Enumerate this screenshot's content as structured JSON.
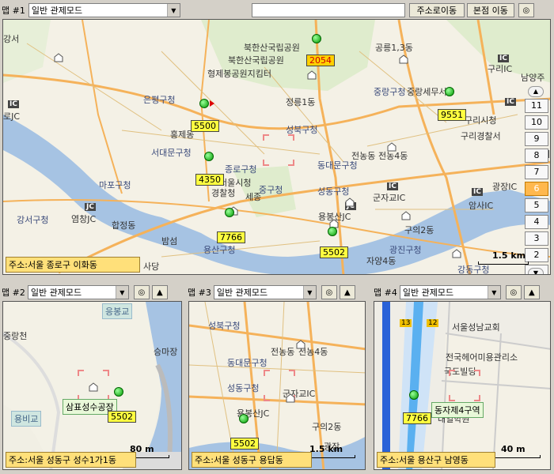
{
  "top": {
    "map_label": "맵 #1",
    "mode": "일반 관제모드",
    "address_input": "",
    "btn_address_move": "주소로이동",
    "btn_branch_move": "본점 이동"
  },
  "map1": {
    "labels": [
      {
        "t": "북한산국립공원",
        "c": "ml"
      },
      {
        "t": "북한산국립공원",
        "c": "ml"
      },
      {
        "t": "형제봉공원지킴터",
        "c": "ml"
      },
      {
        "t": "공릉1,3동",
        "c": "ml"
      },
      {
        "t": "구리IC",
        "c": "ml"
      },
      {
        "t": "남양주",
        "c": "ml"
      },
      {
        "t": "중랑구청",
        "c": "ml blue"
      },
      {
        "t": "중랑세무서",
        "c": "ml"
      },
      {
        "t": "구리시청",
        "c": "ml"
      },
      {
        "t": "구리경찰서",
        "c": "ml"
      },
      {
        "t": "은평구청",
        "c": "ml blue"
      },
      {
        "t": "정릉1동",
        "c": "ml"
      },
      {
        "t": "성북구청",
        "c": "ml blue"
      },
      {
        "t": "홍제동",
        "c": "ml"
      },
      {
        "t": "서대문구청",
        "c": "ml blue"
      },
      {
        "t": "종로구청",
        "c": "ml blue"
      },
      {
        "t": "서울시청",
        "c": "ml"
      },
      {
        "t": "경찰청",
        "c": "ml"
      },
      {
        "t": "세종",
        "c": "ml"
      },
      {
        "t": "중구청",
        "c": "ml blue"
      },
      {
        "t": "동대문구청",
        "c": "ml blue"
      },
      {
        "t": "전농동",
        "c": "ml"
      },
      {
        "t": "전농4동",
        "c": "ml"
      },
      {
        "t": "성동구청",
        "c": "ml blue"
      },
      {
        "t": "군자교IC",
        "c": "ml"
      },
      {
        "t": "광장IC",
        "c": "ml"
      },
      {
        "t": "암사IC",
        "c": "ml"
      },
      {
        "t": "용봉산JC",
        "c": "ml"
      },
      {
        "t": "마포구청",
        "c": "ml blue"
      },
      {
        "t": "강서구청",
        "c": "ml blue"
      },
      {
        "t": "염창JC",
        "c": "ml"
      },
      {
        "t": "합정동",
        "c": "ml"
      },
      {
        "t": "밤섬",
        "c": "ml"
      },
      {
        "t": "용산구청",
        "c": "ml blue"
      },
      {
        "t": "사당",
        "c": "ml"
      },
      {
        "t": "구의2동",
        "c": "ml"
      },
      {
        "t": "광진구청",
        "c": "ml blue"
      },
      {
        "t": "자양4동",
        "c": "ml"
      },
      {
        "t": "강동구청",
        "c": "ml blue"
      },
      {
        "t": "로JC",
        "c": "ml"
      },
      {
        "t": "강서",
        "c": "ml"
      }
    ],
    "vehicles": [
      "2054",
      "9551",
      "5500",
      "4350",
      "7766",
      "5502"
    ],
    "zoom_levels": [
      "11",
      "10",
      "9",
      "8",
      "7",
      "6",
      "5",
      "4",
      "3",
      "2",
      "1"
    ],
    "zoom_selected": "6",
    "scale": "1.5 km",
    "address": "주소:서울 종로구 이화동"
  },
  "map2": {
    "map_label": "맵 #2",
    "mode": "일반 관제모드",
    "labels": [
      "응봉교",
      "중랑천",
      "승마장",
      "용비교",
      "삼표성수공장"
    ],
    "vehicle": "5502",
    "scale": "80 m",
    "address": "주소:서울 성동구 성수1가1동"
  },
  "map3": {
    "map_label": "맵 #3",
    "mode": "일반 관제모드",
    "labels": [
      "성북구청",
      "전농동",
      "전농4동",
      "동대문구청",
      "성동구청",
      "군자교IC",
      "용봉산JC",
      "구의2동",
      "광장"
    ],
    "vehicle": "5502",
    "scale": "1.5 km",
    "address": "주소:서울 성동구 용답동"
  },
  "map4": {
    "map_label": "맵 #4",
    "mode": "일반 관제모드",
    "labels": [
      "서울성남교회",
      "전국헤어미용관리소",
      "국도빌딩",
      "대일학원",
      "동자제4구역"
    ],
    "road_badges": [
      "13",
      "12"
    ],
    "vehicle": "7766",
    "scale": "40 m",
    "address": "주소:서울 용산구 남영동"
  }
}
